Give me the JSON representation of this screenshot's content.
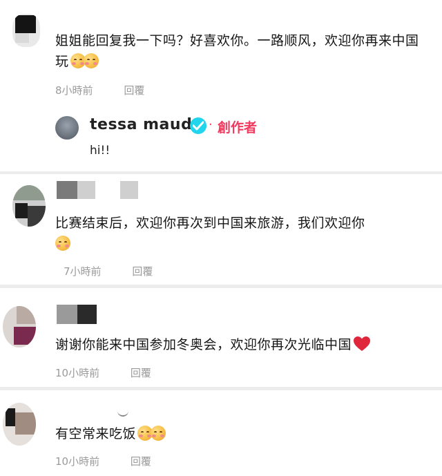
{
  "comments": [
    {
      "text": "姐姐能回复我一下吗？好喜欢你。一路顺风，欢迎你再来中国玩",
      "emoji": [
        "smiling-face-with-hearts",
        "smiling-face-with-hearts"
      ],
      "time": "8小時前",
      "reply_label": "回覆",
      "creator_reply": {
        "name": "tessa maud",
        "badge": "verified",
        "separator": "·",
        "role_label": "創作者",
        "text": "hi!!"
      }
    },
    {
      "text": "比赛结束后，欢迎你再次到中国来旅游，我们欢迎你",
      "emoji": [
        "smiling-face-with-hearts"
      ],
      "time": "7小時前",
      "reply_label": "回覆"
    },
    {
      "text": "谢谢你能来中国参加冬奥会，欢迎你再次光临中国",
      "emoji": [
        "red-heart"
      ],
      "time": "10小時前",
      "reply_label": "回覆"
    },
    {
      "text": "有空常来吃饭",
      "emoji": [
        "smiling-face-with-hearts",
        "smiling-face-with-hearts"
      ],
      "time": "10小時前",
      "reply_label": "回覆"
    }
  ],
  "colors": {
    "creator_accent": "#f03a5f",
    "verified_badge": "#20d5ec",
    "meta_text": "#9a9a9a"
  }
}
